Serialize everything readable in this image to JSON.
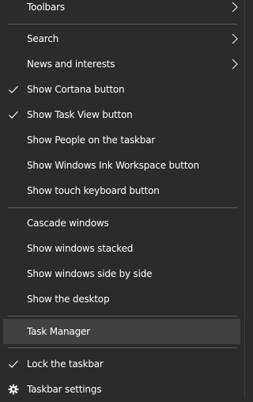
{
  "menu": {
    "items": [
      {
        "label": "Toolbars",
        "submenu": true
      },
      {
        "label": "Search",
        "submenu": true
      },
      {
        "label": "News and interests",
        "submenu": true
      },
      {
        "label": "Show Cortana button",
        "checked": true
      },
      {
        "label": "Show Task View button",
        "checked": true
      },
      {
        "label": "Show People on the taskbar"
      },
      {
        "label": "Show Windows Ink Workspace button"
      },
      {
        "label": "Show touch keyboard button"
      },
      {
        "label": "Cascade windows"
      },
      {
        "label": "Show windows stacked"
      },
      {
        "label": "Show windows side by side"
      },
      {
        "label": "Show the desktop"
      },
      {
        "label": "Task Manager",
        "highlighted": true
      },
      {
        "label": "Lock the taskbar",
        "checked": true
      },
      {
        "label": "Taskbar settings",
        "icon": "gear-icon"
      }
    ]
  },
  "colors": {
    "background": "#2b2b2b",
    "highlight": "#414141",
    "separator": "#595959",
    "text": "#ffffff"
  }
}
